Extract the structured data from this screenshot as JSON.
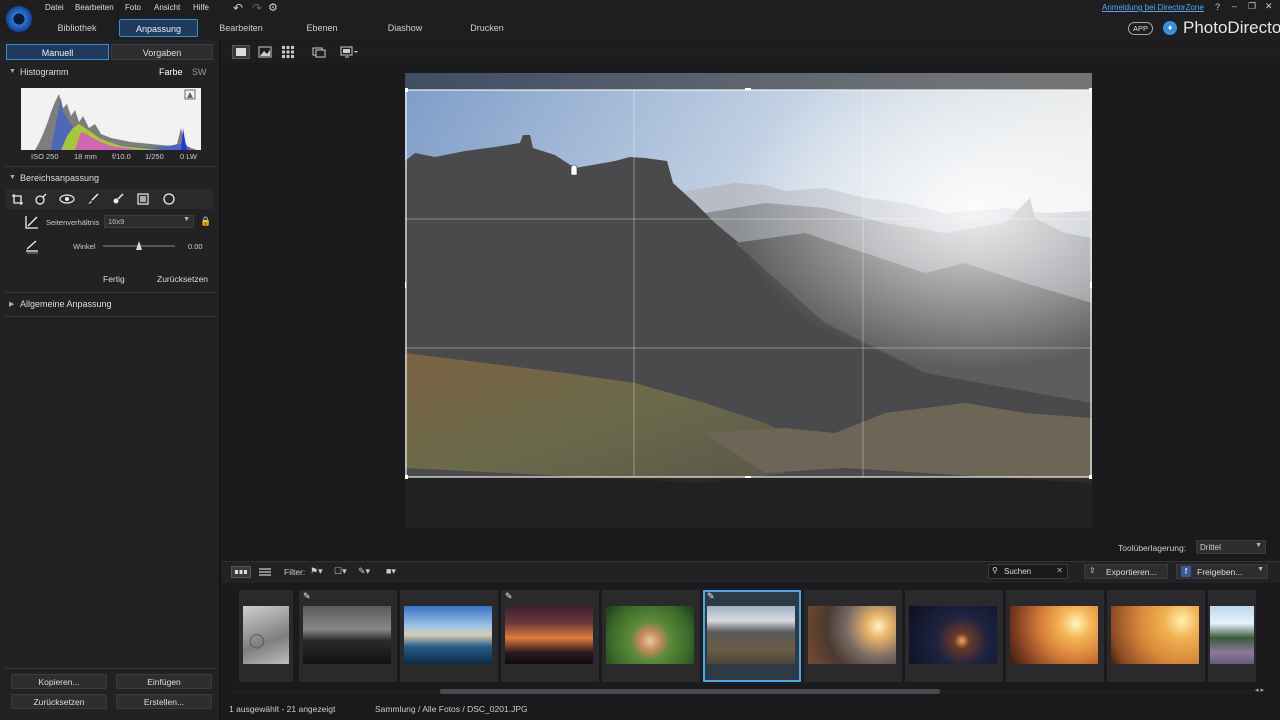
{
  "menu": [
    "Datei",
    "Bearbeiten",
    "Foto",
    "Ansicht",
    "Hilfe"
  ],
  "nav_tabs": [
    "Bibliothek",
    "Anpassung",
    "Bearbeiten",
    "Ebenen",
    "Diashow",
    "Drucken"
  ],
  "active_tab": "Anpassung",
  "account_link": "Anmeldung bei DirectorZone",
  "app_badge": "APP",
  "app_name": "PhotoDirector",
  "left": {
    "mode_tabs": [
      "Manuell",
      "Vorgaben"
    ],
    "histogram": {
      "title": "Histogramm",
      "color_toggle": "Farbe",
      "bw_toggle": "SW",
      "exif": [
        "ISO 250",
        "18 mm",
        "f/10.0",
        "1/250",
        "0 LW"
      ]
    },
    "regional": {
      "title": "Bereichsanpassung",
      "aspect_label": "Seitenverhältnis",
      "aspect_value": "16x9",
      "angle_label": "Winkel",
      "angle_value": "0.00",
      "angle_level": 0.5,
      "done": "Fertig",
      "reset": "Zurücksetzen"
    },
    "general": "Allgemeine Anpassung",
    "footer_buttons": [
      "Kopieren...",
      "Einfügen",
      "Zurücksetzen",
      "Erstellen..."
    ]
  },
  "overlay": {
    "label": "Toolüberlagerung:",
    "value": "Drittel"
  },
  "filmstrip": {
    "filter_label": "Filter:",
    "search_placeholder": "Suchen",
    "export": "Exportieren...",
    "share": "Freigeben...",
    "status_left": "1 ausgewählt - 21 angezeigt",
    "status_path": "Sammlung / Alle Fotos / DSC_0201.JPG",
    "selected_index": 5
  },
  "colors": {
    "accent": "#3a8ed8",
    "panel": "#222225",
    "background": "#1a1a1c"
  }
}
